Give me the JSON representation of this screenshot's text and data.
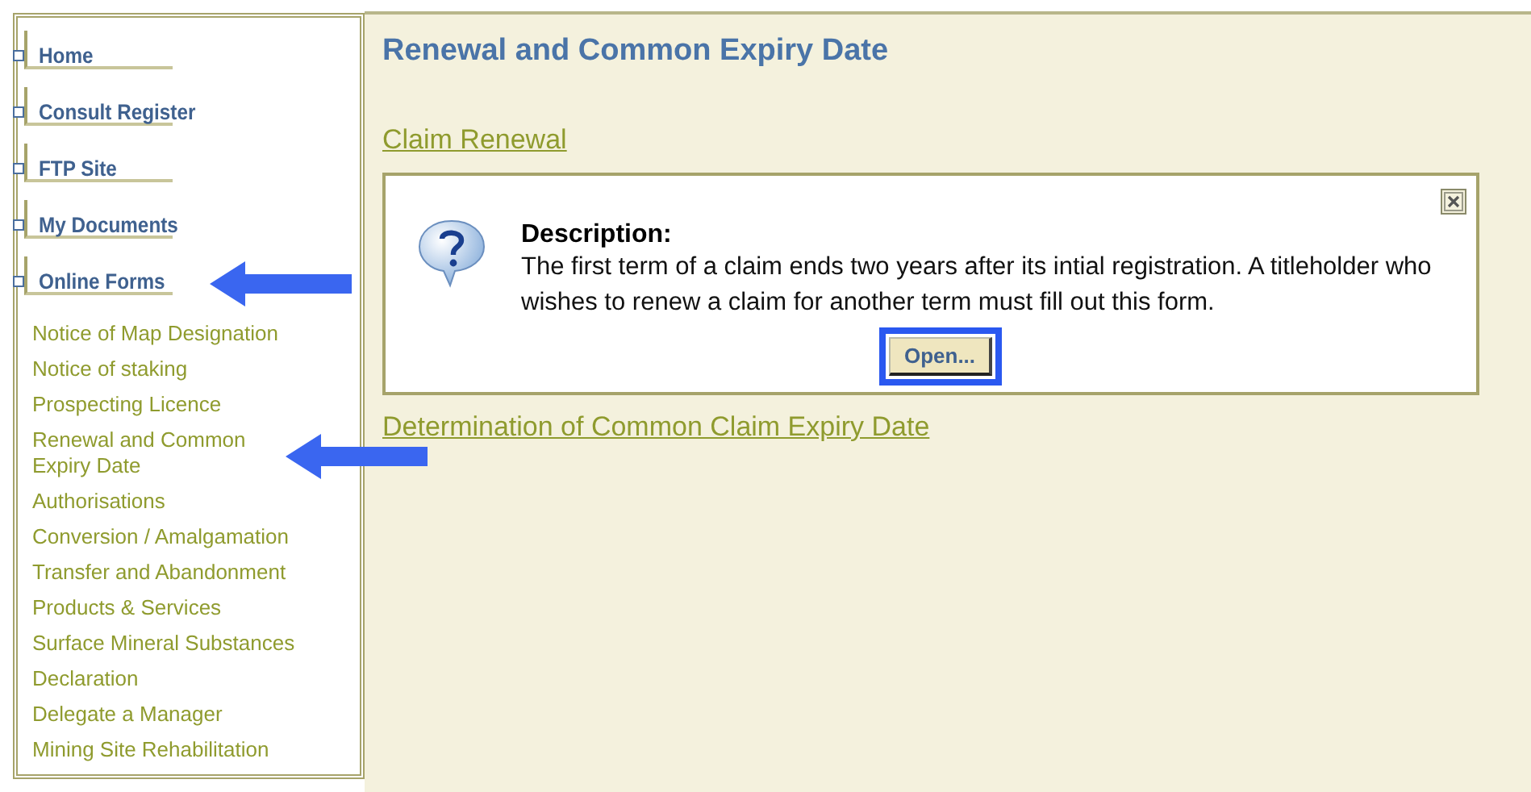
{
  "sidebar": {
    "items": [
      {
        "label": "Home"
      },
      {
        "label": "Consult Register"
      },
      {
        "label": "FTP Site"
      },
      {
        "label": "My Documents"
      },
      {
        "label": "Online Forms",
        "children": [
          {
            "label": "Notice of Map Designation"
          },
          {
            "label": "Notice of staking"
          },
          {
            "label": "Prospecting Licence"
          },
          {
            "label": "Renewal and Common\nExpiry Date"
          },
          {
            "label": "Authorisations"
          },
          {
            "label": "Conversion / Amalgamation"
          },
          {
            "label": "Transfer and Abandonment"
          },
          {
            "label": "Products & Services"
          },
          {
            "label": "Surface Mineral Substances"
          },
          {
            "label": "Declaration"
          },
          {
            "label": "Delegate a Manager"
          },
          {
            "label": "Mining Site Rehabilitation"
          }
        ]
      }
    ]
  },
  "main": {
    "title": "Renewal and Common Expiry Date",
    "links": [
      {
        "label": "Claim Renewal",
        "description_heading": "Description:",
        "description": "The first term of a claim ends two years after its intial registration. A titleholder who wishes to renew a claim for another term must fill out this form.",
        "button": "Open..."
      },
      {
        "label": "Determination of Common Claim Expiry Date"
      }
    ]
  }
}
